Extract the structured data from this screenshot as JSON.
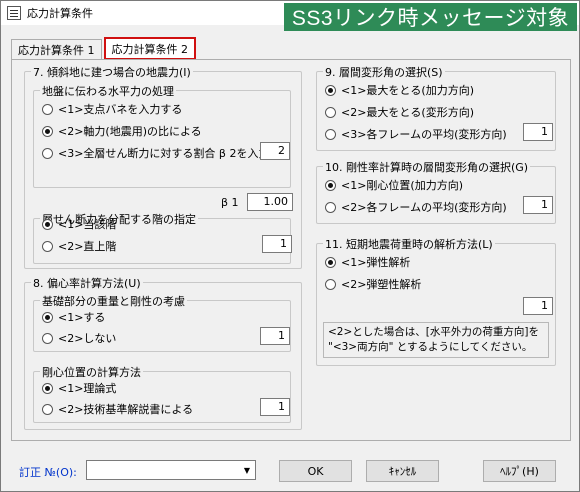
{
  "window": {
    "title": "応力計算条件"
  },
  "banner": {
    "text": "SS3リンク時メッセージ対象"
  },
  "tabs": [
    {
      "label": "応力計算条件 1",
      "active": false
    },
    {
      "label": "応力計算条件 2",
      "active": true
    }
  ],
  "g7": {
    "title": "7. 傾斜地に建つ場合の地震力(I)",
    "sub1": {
      "title": "地盤に伝わる水平力の処理",
      "options": [
        "<1>支点バネを入力する",
        "<2>軸力(地震用)の比による",
        "<3>全層せん断力に対する割合 β 2を入力"
      ],
      "selected": 1,
      "beta2": "2",
      "beta1_label": "β 1",
      "beta1": "1.00"
    },
    "sub2": {
      "title": "層せん断力を分配する階の指定",
      "options": [
        "<1>当該階",
        "<2>直上階"
      ],
      "selected": 0,
      "value": "1"
    }
  },
  "g8": {
    "title": "8. 偏心率計算方法(U)",
    "sub1": {
      "title": "基礎部分の重量と剛性の考慮",
      "options": [
        "<1>する",
        "<2>しない"
      ],
      "selected": 0,
      "value": "1"
    },
    "sub2": {
      "title": "剛心位置の計算方法",
      "options": [
        "<1>理論式",
        "<2>技術基準解説書による"
      ],
      "selected": 0,
      "value": "1"
    }
  },
  "g9": {
    "title": "9. 層間変形角の選択(S)",
    "options": [
      "<1>最大をとる(加力方向)",
      "<2>最大をとる(変形方向)",
      "<3>各フレームの平均(変形方向)"
    ],
    "selected": 0,
    "value": "1"
  },
  "g10": {
    "title": "10. 剛性率計算時の層間変形角の選択(G)",
    "options": [
      "<1>剛心位置(加力方向)",
      "<2>各フレームの平均(変形方向)"
    ],
    "selected": 0,
    "value": "1"
  },
  "g11": {
    "title": "11. 短期地震荷重時の解析方法(L)",
    "options": [
      "<1>弾性解析",
      "<2>弾塑性解析"
    ],
    "selected": 0,
    "value": "1",
    "note": "<2>とした場合は、[水平外力の荷重方向]を \"<3>両方向\" とするようにしてください。"
  },
  "bottom": {
    "correction_label": "訂正 №(O):",
    "correction_value": "",
    "ok": "OK",
    "cancel": "ｷｬﾝｾﾙ",
    "help": "ﾍﾙﾌﾟ(H)"
  }
}
